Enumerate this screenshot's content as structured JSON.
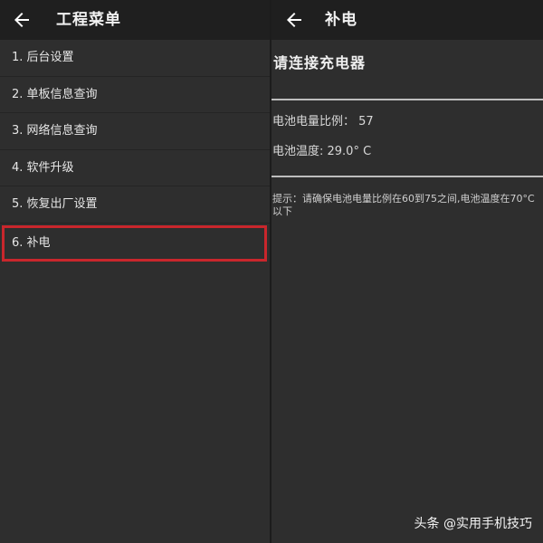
{
  "left_pane": {
    "title": "工程菜单",
    "menu": [
      {
        "label": "1. 后台设置"
      },
      {
        "label": "2. 单板信息查询"
      },
      {
        "label": "3. 网络信息查询"
      },
      {
        "label": "4. 软件升级"
      },
      {
        "label": "5. 恢复出厂设置"
      },
      {
        "label": "6. 补电",
        "selected": true
      }
    ],
    "highlight_color": "#c9262c"
  },
  "right_pane": {
    "title": "补电",
    "heading": "请连接充电器",
    "battery_level": "电池电量比例： 57",
    "battery_temp": "电池温度: 29.0° C",
    "hint": "提示：请确保电池电量比例在60到75之间,电池温度在70°C以下"
  },
  "watermark": "头条 @实用手机技巧",
  "icons": {
    "back": "arrow-left-icon"
  }
}
